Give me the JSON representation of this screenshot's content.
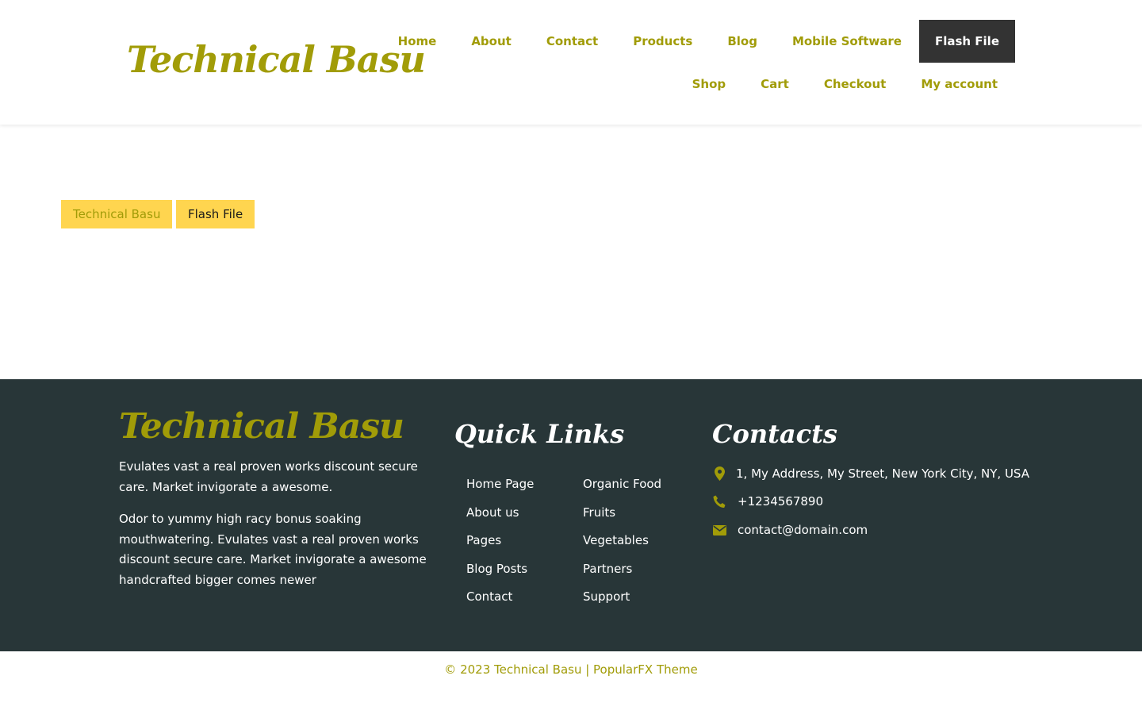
{
  "site": {
    "logo": "Technical Basu"
  },
  "nav": {
    "row1": [
      {
        "label": "Home",
        "name": "nav-home"
      },
      {
        "label": "About",
        "name": "nav-about"
      },
      {
        "label": "Contact",
        "name": "nav-contact"
      },
      {
        "label": "Products",
        "name": "nav-products"
      },
      {
        "label": "Blog",
        "name": "nav-blog"
      },
      {
        "label": "Mobile Software",
        "name": "nav-mobile-software"
      },
      {
        "label": "Flash File",
        "name": "nav-flash-file"
      }
    ],
    "row2": [
      {
        "label": "Shop",
        "name": "nav-shop"
      },
      {
        "label": "Cart",
        "name": "nav-cart"
      },
      {
        "label": "Checkout",
        "name": "nav-checkout"
      },
      {
        "label": "My account",
        "name": "nav-my-account"
      }
    ]
  },
  "breadcrumb": {
    "home": "Technical Basu",
    "current": "Flash File"
  },
  "footer": {
    "logo": "Technical Basu",
    "para1": "Evulates vast a real proven works discount secure care. Market invigorate a awesome.",
    "para2": "Odor to yummy high racy bonus soaking mouthwatering. Evulates vast a real proven works discount secure care. Market invigorate a awesome handcrafted bigger comes newer",
    "quick_links_title": "Quick Links",
    "links_col1": [
      "Home Page",
      "About us",
      "Pages",
      "Blog Posts",
      "Contact"
    ],
    "links_col2": [
      "Organic Food",
      "Fruits",
      "Vegetables",
      "Partners",
      "Support"
    ],
    "contacts_title": "Contacts",
    "address": "1, My Address, My Street, New York City, NY, USA",
    "phone": "+1234567890",
    "email": "contact@domain.com"
  },
  "copyright": "© 2023 Technical Basu | PopularFX Theme",
  "colors": {
    "accent": "#a19c08",
    "footer_bg": "#283638",
    "breadcrumb_bg": "#ffd54f",
    "active_nav_bg": "#333333"
  }
}
